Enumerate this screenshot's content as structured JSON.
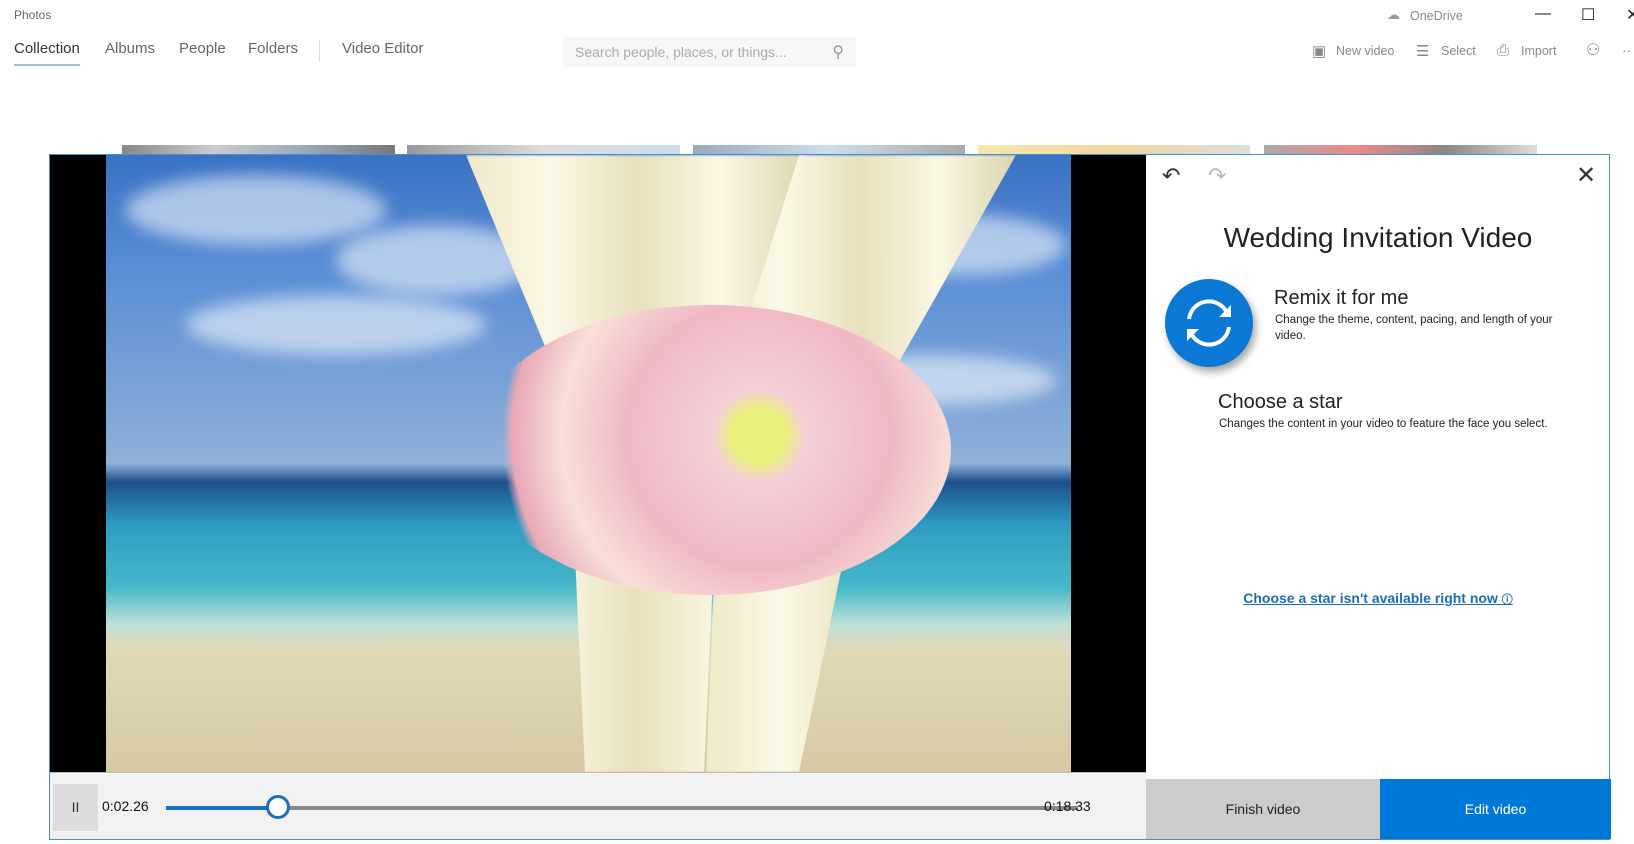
{
  "app": {
    "title": "Photos"
  },
  "nav": {
    "tabs": [
      {
        "label": "Collection",
        "active": true
      },
      {
        "label": "Albums"
      },
      {
        "label": "People"
      },
      {
        "label": "Folders"
      },
      {
        "label": "Video Editor"
      }
    ]
  },
  "search": {
    "placeholder": "Search people, places, or things..."
  },
  "titlebar": {
    "onedrive": "OneDrive",
    "minimize": "—",
    "maximize": "☐",
    "close": "✕"
  },
  "toolbar": {
    "new_video": "New video",
    "select": "Select",
    "import": "Import"
  },
  "dialog": {
    "title": "Wedding Invitation Video",
    "remix": {
      "title": "Remix it for me",
      "description": "Change the theme, content, pacing, and length of your video."
    },
    "star": {
      "title": "Choose a star",
      "description": "Changes the content in your video to feature the face you select.",
      "unavailable_link": "Choose a star isn't available right now"
    },
    "finish_label": "Finish video",
    "edit_label": "Edit video"
  },
  "player": {
    "current_time": "0:02.26",
    "total_time": "0:18.33",
    "progress_percent": 12.3,
    "pause_glyph": "II"
  },
  "colors": {
    "accent": "#0078d7",
    "link": "#1a6fb8"
  }
}
